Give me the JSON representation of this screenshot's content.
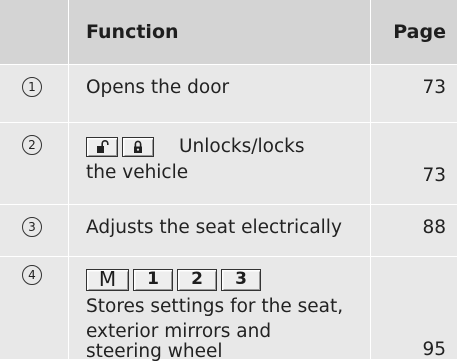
{
  "table": {
    "header": {
      "function": "Function",
      "page": "Page"
    },
    "rows": [
      {
        "number": "1",
        "lines": [
          "Opens the door"
        ],
        "page": "73"
      },
      {
        "number": "2",
        "keys": [
          "unlock-icon",
          "lock-icon"
        ],
        "lines": [
          "Unlocks/locks",
          "the vehicle"
        ],
        "page": "73"
      },
      {
        "number": "3",
        "lines": [
          "Adjusts the seat electrically"
        ],
        "page": "88"
      },
      {
        "number": "4",
        "keys": [
          "M",
          "1",
          "2",
          "3"
        ],
        "lines": [
          "Stores settings for the seat,",
          "exterior mirrors and",
          "steering wheel"
        ],
        "page": "95"
      }
    ]
  },
  "colors": {
    "header_bg": "#d4d4d4",
    "row_bg": "#e8e8e8",
    "divider": "#ffffff",
    "text": "#222222"
  }
}
